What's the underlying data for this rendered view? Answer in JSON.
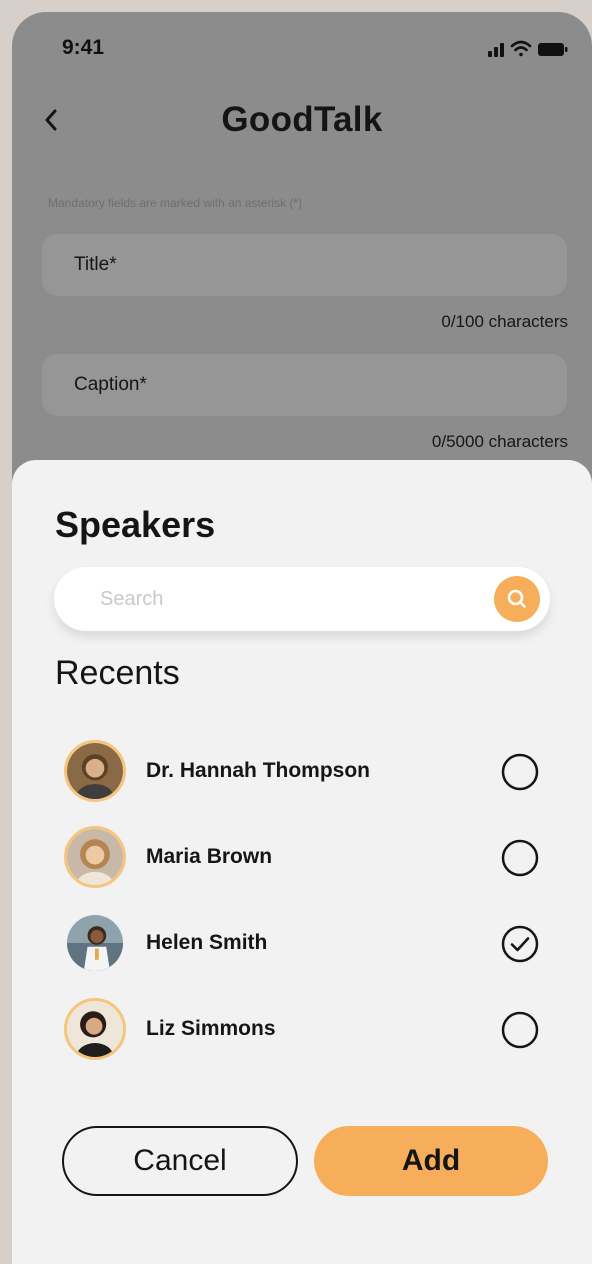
{
  "status_bar": {
    "time": "9:41"
  },
  "header": {
    "title": "GoodTalk",
    "back_icon": "chevron-left-icon"
  },
  "form": {
    "mandatory_hint": "Mandatory fields are marked with an asterisk (*)",
    "title_field": {
      "label": "Title*",
      "counter": "0/100 characters"
    },
    "caption_field": {
      "label": "Caption*",
      "counter": "0/5000 characters"
    }
  },
  "sheet": {
    "title": "Speakers",
    "search": {
      "placeholder": "Search",
      "value": "",
      "icon": "search-icon"
    },
    "section_label": "Recents",
    "speakers": [
      {
        "name": "Dr. Hannah Thompson",
        "selected": false
      },
      {
        "name": "Maria Brown",
        "selected": false
      },
      {
        "name": "Helen Smith",
        "selected": true
      },
      {
        "name": "Liz Simmons",
        "selected": false
      }
    ],
    "cancel_label": "Cancel",
    "add_label": "Add"
  },
  "colors": {
    "accent": "#f7ae5b",
    "overlay": "#8c8c8c",
    "sheet_bg": "#f2f2f2",
    "text": "#151515"
  }
}
